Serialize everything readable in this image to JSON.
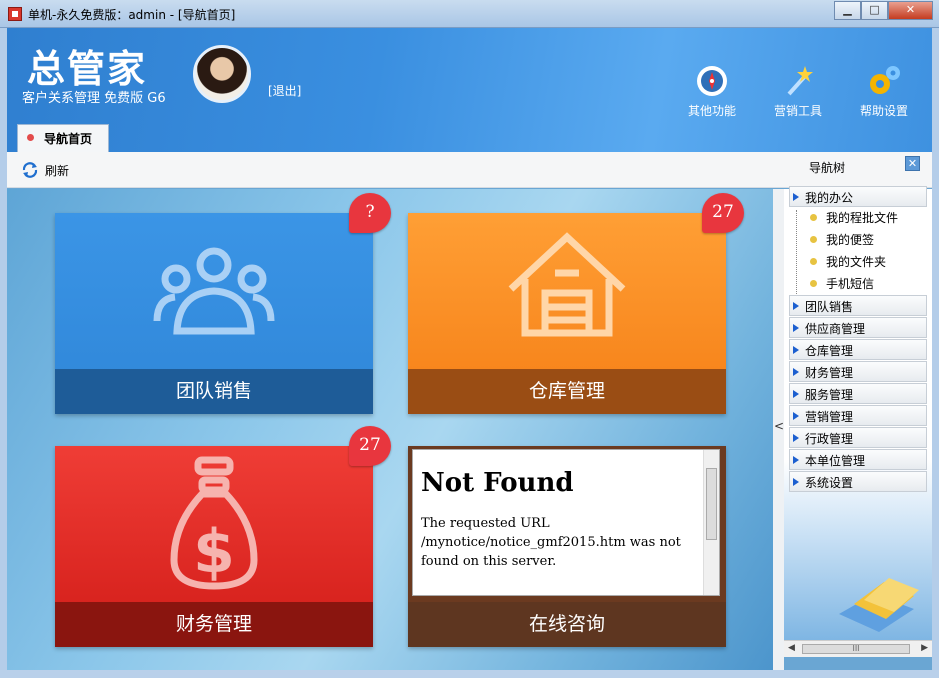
{
  "window": {
    "title": "单机-永久免费版：admin - [导航首页]",
    "minimize": "▁",
    "maximize": "□",
    "close": "✕"
  },
  "header": {
    "logo": "总管家",
    "subtitle": "客户关系管理 免费版 G6",
    "logout": "[退出]",
    "buttons": [
      {
        "label": "其他功能",
        "icon": "compass-icon"
      },
      {
        "label": "营销工具",
        "icon": "magic-wand-icon"
      },
      {
        "label": "帮助设置",
        "icon": "gears-icon"
      }
    ],
    "tab": "导航首页"
  },
  "toolbar": {
    "refresh": "刷新"
  },
  "tiles": [
    {
      "label": "团队销售",
      "badge": "?",
      "color": "#2f86d8"
    },
    {
      "label": "仓库管理",
      "badge": "27",
      "color": "#f57f16"
    },
    {
      "label": "财务管理",
      "badge": "27",
      "color": "#d21c18"
    },
    {
      "label": "在线咨询",
      "color": "#6b3a20"
    }
  ],
  "notice": {
    "heading": "Not Found",
    "body": "The requested URL /mynotice/notice_gmf2015.htm was not found on this server."
  },
  "side": {
    "title": "导航树",
    "close": "✕",
    "collapse": "<",
    "open_group": "我的办公",
    "sub_items": [
      "我的程批文件",
      "我的便签",
      "我的文件夹",
      "手机短信"
    ],
    "groups": [
      "团队销售",
      "供应商管理",
      "仓库管理",
      "财务管理",
      "服务管理",
      "营销管理",
      "行政管理",
      "本单位管理",
      "系统设置"
    ],
    "scroll_thumb": "III"
  }
}
